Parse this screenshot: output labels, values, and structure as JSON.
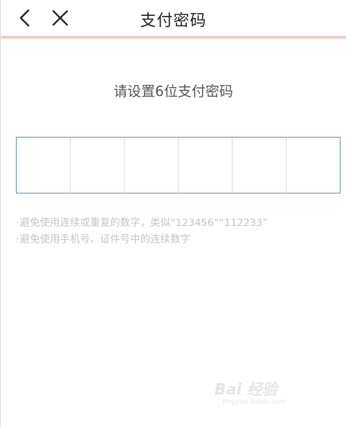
{
  "header": {
    "back_icon": "chevron-left-icon",
    "close_icon": "close-icon",
    "title": "支付密码"
  },
  "prompt": "请设置6位支付密码",
  "pin": {
    "length": 6,
    "cells": [
      "",
      "",
      "",
      "",
      "",
      ""
    ]
  },
  "hints": [
    {
      "bullet": "·",
      "text": "避免使用连续或重复的数字，类似“123456”“112233”"
    },
    {
      "bullet": "·",
      "text": "避免使用手机号、证件号中的连续数字"
    }
  ],
  "watermark": {
    "main": "Bai 经验",
    "sub": "jingyan.baidu.com"
  },
  "colors": {
    "header_border": "#f4c9c6",
    "pin_border": "#5b86c7",
    "hint_text": "#c4c4c4",
    "prompt_text": "#555555"
  }
}
